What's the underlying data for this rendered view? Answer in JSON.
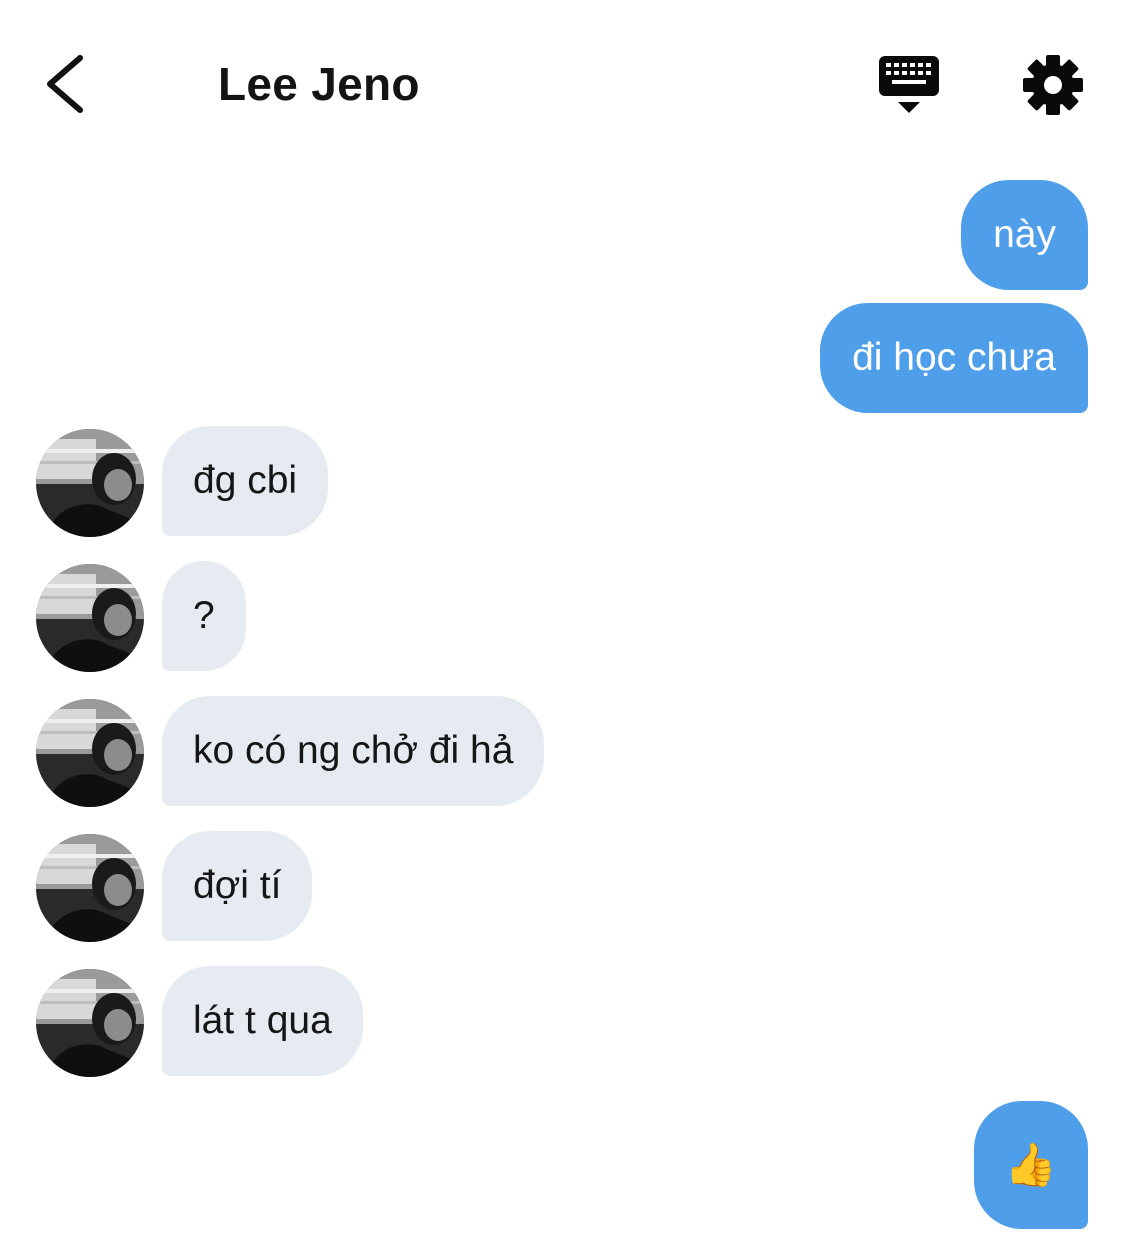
{
  "header": {
    "title": "Lee Jeno"
  },
  "icons": {
    "back": "chevron-left-icon",
    "keyboard": "keyboard-icon",
    "settings": "gear-icon"
  },
  "colors": {
    "outgoing_bubble": "#4f9ee9",
    "incoming_bubble": "#e5ebf0",
    "text_dark": "#141414"
  },
  "messages": [
    {
      "from": "me",
      "text": "này"
    },
    {
      "from": "me",
      "text": "đi học chưa"
    },
    {
      "from": "Lee Jeno",
      "text": "đg cbi"
    },
    {
      "from": "Lee Jeno",
      "text": "?"
    },
    {
      "from": "Lee Jeno",
      "text": "ko có ng chở đi hả"
    },
    {
      "from": "Lee Jeno",
      "text": "đợi tí"
    },
    {
      "from": "Lee Jeno",
      "text": "lát t qua"
    },
    {
      "from": "me",
      "text": "👍"
    }
  ]
}
